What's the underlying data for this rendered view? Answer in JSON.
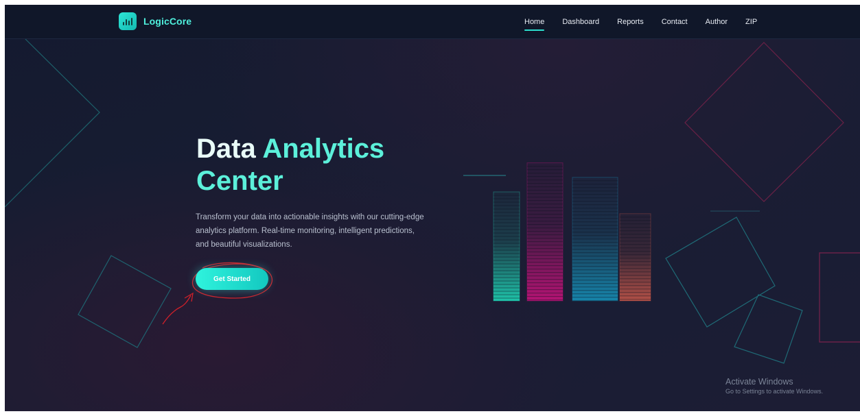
{
  "header": {
    "brand": "LogicCore",
    "logo_icon": "bar-chart-icon",
    "nav": [
      "Home",
      "Dashboard",
      "Reports",
      "Contact",
      "Author",
      "ZIP"
    ],
    "active_nav": "Home"
  },
  "hero": {
    "title_part1": "Data ",
    "title_part2": "Analytics",
    "title_part3": "Center",
    "description": "Transform your data into actionable insights with our cutting-edge analytics platform. Real-time monitoring, intelligent predictions, and beautiful visualizations.",
    "cta_label": "Get Started"
  },
  "illustration": {
    "bar_levels": [
      0.75,
      0.95,
      0.85,
      0.6
    ],
    "bar_colors": [
      "#1fd3b4",
      "#c4127a",
      "#168fb6",
      "#c25548"
    ]
  },
  "watermark": {
    "title": "Activate Windows",
    "subtitle": "Go to Settings to activate Windows."
  },
  "colors": {
    "accent": "#2ee6d6",
    "background": "#161b31",
    "annotation": "#d0202a"
  }
}
